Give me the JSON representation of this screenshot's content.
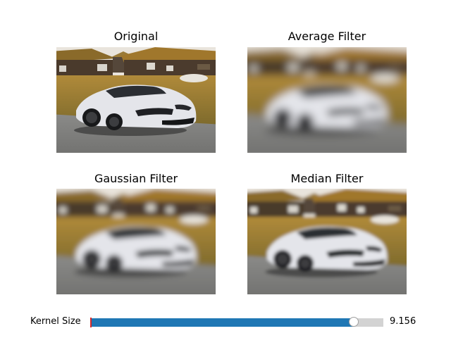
{
  "panels": [
    {
      "title": "Original",
      "blur": 0
    },
    {
      "title": "Average Filter",
      "blur": 6
    },
    {
      "title": "Gaussian Filter",
      "blur": 4
    },
    {
      "title": "Median Filter",
      "blur": 2.5
    }
  ],
  "slider": {
    "label": "Kernel Size",
    "value_text": "9.156",
    "value_fraction": 0.9
  },
  "colors": {
    "slider_fill": "#1f77b4",
    "slider_track": "#d3d3d3",
    "min_marker": "#d62728"
  }
}
